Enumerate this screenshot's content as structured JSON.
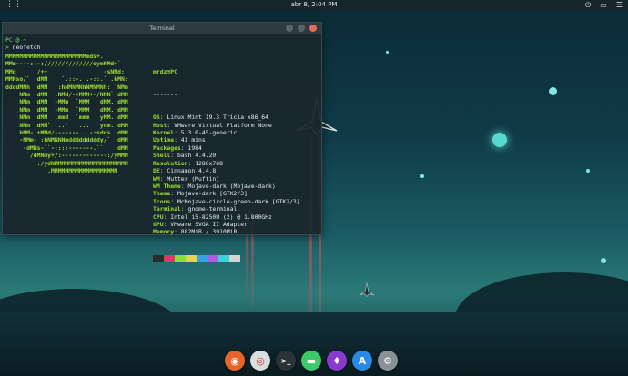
{
  "topbar": {
    "clock": "abr 8,  2:04 PM",
    "icons": [
      "power-icon",
      "drive-icon",
      "menu-icon"
    ]
  },
  "terminal": {
    "title": "Terminal",
    "prompt": "PC @ ~",
    "prompt_symbol": ">",
    "command": "neofetch",
    "art": [
      "MMMMMMMMMMMMMMMMMMMMMMMmds+.",
      "MMm----::-://////////////oymNMd+`",
      "MMd      /++                -sNMd:",
      "MMNso/`  dMM    `.::-. .-::.` .hMN:",
      "ddddMMh  dMM   :hNMNMNhNMNMNh: `NMm",
      "    NMm  dMM  .NMN/-+MMM+-/NMN` dMM",
      "    NMm  dMM  -MMm  `MMM   dMM. dMM",
      "    NMm  dMM  -MMm  `MMM   dMM. dMM",
      "    NMm  dMM  .mmd  `mmm   yMM. dMM",
      "    NMm  dMM`  ..`   ...   ydm. dMM",
      "    hMM- +MMd/-------...-:sdds  dMM",
      "    -NMm- :hNMNNNmdddddddddy/`  dMM",
      "     -dMNs-``-::::-------.``    dMM",
      "      `/dMNmy+/:-------------:/yMMM",
      "         ./ydNMMMMMMMMMMMMMMMMMMMMM",
      "            .MMMMMMMMMMMMMMMMMMM"
    ],
    "user_host": "mrdz@PC",
    "separator": "-------",
    "info": [
      {
        "k": "OS",
        "v": "Linux Mint 19.3 Tricia x86_64"
      },
      {
        "k": "Host",
        "v": "VMware Virtual Platform None"
      },
      {
        "k": "Kernel",
        "v": "5.3.0-45-generic"
      },
      {
        "k": "Uptime",
        "v": "41 mins"
      },
      {
        "k": "Packages",
        "v": "1984"
      },
      {
        "k": "Shell",
        "v": "bash 4.4.20"
      },
      {
        "k": "Resolution",
        "v": "1280x768"
      },
      {
        "k": "DE",
        "v": "Cinnamon 4.4.8"
      },
      {
        "k": "WM",
        "v": "Mutter (Muffin)"
      },
      {
        "k": "WM Theme",
        "v": "Mojave-dark (Mojave-dark)"
      },
      {
        "k": "Theme",
        "v": "Mojave-dark [GTK2/3]"
      },
      {
        "k": "Icons",
        "v": "McMojave-circle-green-dark [GTK2/3]"
      },
      {
        "k": "Terminal",
        "v": "gnome-terminal"
      },
      {
        "k": "CPU",
        "v": "Intel i5-8250U (2) @ 1.800GHz"
      },
      {
        "k": "GPU",
        "v": "VMware SVGA II Adapter"
      },
      {
        "k": "Memory",
        "v": "882MiB / 3910MiB"
      }
    ],
    "swatches": [
      "#2b2b2b",
      "#e6336a",
      "#8be22a",
      "#e8d64a",
      "#3aa0e8",
      "#b25ae0",
      "#3ad1d8",
      "#d0d6d8"
    ]
  },
  "dock": {
    "items": [
      {
        "name": "firefox",
        "icon": "firefox-icon",
        "color": "#e8642a",
        "glyph": "◉"
      },
      {
        "name": "chrome",
        "icon": "chrome-icon",
        "color": "#d8dde0",
        "glyph": "◎"
      },
      {
        "name": "terminal",
        "icon": "terminal-icon",
        "color": "#2c3338",
        "glyph": ">_"
      },
      {
        "name": "files",
        "icon": "folder-icon",
        "color": "#3fc96a",
        "glyph": "▬"
      },
      {
        "name": "torch",
        "icon": "torch-icon",
        "color": "#8b3ad0",
        "glyph": "♦"
      },
      {
        "name": "app-store",
        "icon": "app-store-icon",
        "color": "#2a8ae8",
        "glyph": "A"
      },
      {
        "name": "settings",
        "icon": "settings-icon",
        "color": "#8a9195",
        "glyph": "⚙"
      }
    ]
  }
}
